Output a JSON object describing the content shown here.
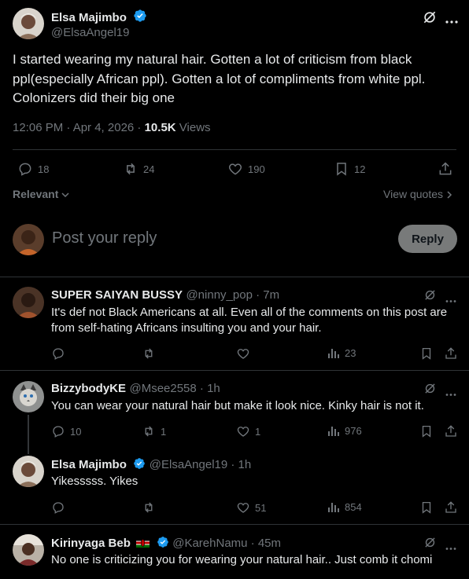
{
  "main_tweet": {
    "author_name": "Elsa Majimbo",
    "author_handle": "@ElsaAngel19",
    "text_lines": [
      "I started wearing my natural hair. Gotten a lot of criticism from black",
      "ppl(especially African ppl). Gotten a lot of compliments from white ppl.",
      "Colonizers did their big one"
    ],
    "time": "12:06 PM · Apr 4, 2026 · ",
    "views_count": "10.5K",
    "views_label": " Views",
    "stats": {
      "replies": "18",
      "reposts": "24",
      "likes": "190",
      "bookmarks": "12"
    }
  },
  "sort": {
    "label": "Relevant",
    "view_quotes": "View quotes"
  },
  "composer": {
    "placeholder": "Post your reply",
    "button": "Reply"
  },
  "replies": [
    {
      "name": "SUPER SAIYAN BUSSY",
      "handle": "@ninny_pop · 7m",
      "text_lines": [
        "It's def not Black Americans at all. Even all of the comments on this post are",
        "from self-hating Africans insulting you and your hair."
      ],
      "stats": {
        "replies": "",
        "reposts": "",
        "likes": "",
        "views": "23"
      }
    },
    {
      "name": "BizzybodyKE",
      "handle": "@Msee2558 · 1h",
      "text_lines": [
        "You can wear your natural hair but make it look nice. Kinky hair is not it."
      ],
      "stats": {
        "replies": "10",
        "reposts": "1",
        "likes": "1",
        "views": "976"
      }
    },
    {
      "name": "Elsa Majimbo",
      "handle": "@ElsaAngel19 · 1h",
      "text_lines": [
        "Yikesssss. Yikes"
      ],
      "stats": {
        "replies": "",
        "reposts": "",
        "likes": "51",
        "views": "854"
      }
    },
    {
      "name": "Kirinyaga Beb",
      "handle": "@KarehNamu · 45m",
      "text_lines": [
        "No one is criticizing you for wearing your natural hair.. Just comb it chomi"
      ],
      "stats": {
        "replies": "",
        "reposts": "",
        "likes": "",
        "views": ""
      }
    }
  ],
  "colors": {
    "background": "#000000",
    "text": "#e7e9ea",
    "muted": "#71767b",
    "verified": "#1d9bf0",
    "divider": "#2f3336"
  }
}
